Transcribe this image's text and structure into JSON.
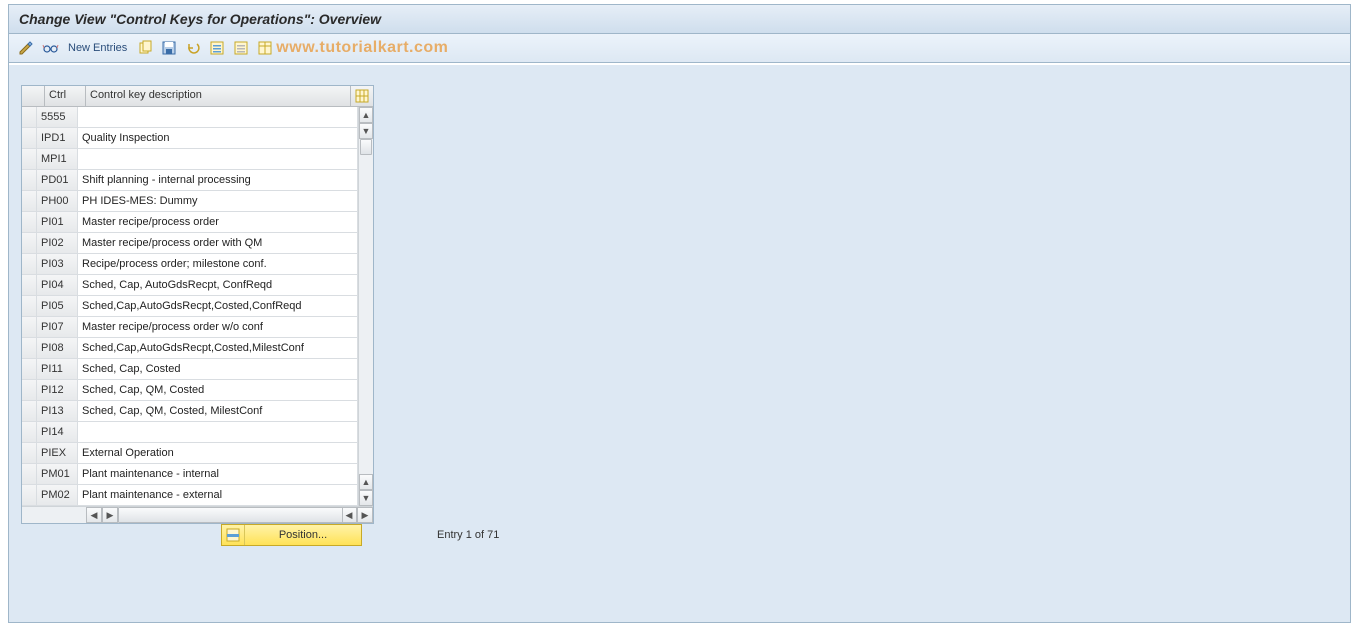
{
  "title": "Change View \"Control Keys for Operations\": Overview",
  "toolbar": {
    "new_entries": "New Entries"
  },
  "watermark": "www.tutorialkart.com",
  "table": {
    "headers": {
      "ctrl": "Ctrl",
      "desc": "Control key description"
    },
    "rows": [
      {
        "ctrl": "5555",
        "desc": ""
      },
      {
        "ctrl": "IPD1",
        "desc": "Quality Inspection"
      },
      {
        "ctrl": "MPI1",
        "desc": ""
      },
      {
        "ctrl": "PD01",
        "desc": "Shift planning - internal processing"
      },
      {
        "ctrl": "PH00",
        "desc": "PH IDES-MES: Dummy"
      },
      {
        "ctrl": "PI01",
        "desc": "Master recipe/process order"
      },
      {
        "ctrl": "PI02",
        "desc": "Master recipe/process order with QM"
      },
      {
        "ctrl": "PI03",
        "desc": "Recipe/process order; milestone conf."
      },
      {
        "ctrl": "PI04",
        "desc": "Sched, Cap, AutoGdsRecpt, ConfReqd"
      },
      {
        "ctrl": "PI05",
        "desc": "Sched,Cap,AutoGdsRecpt,Costed,ConfReqd"
      },
      {
        "ctrl": "PI07",
        "desc": "Master recipe/process order w/o conf"
      },
      {
        "ctrl": "PI08",
        "desc": "Sched,Cap,AutoGdsRecpt,Costed,MilestConf"
      },
      {
        "ctrl": "PI11",
        "desc": "Sched, Cap, Costed"
      },
      {
        "ctrl": "PI12",
        "desc": "Sched, Cap, QM, Costed"
      },
      {
        "ctrl": "PI13",
        "desc": "Sched, Cap, QM, Costed, MilestConf"
      },
      {
        "ctrl": "PI14",
        "desc": ""
      },
      {
        "ctrl": "PIEX",
        "desc": "External Operation"
      },
      {
        "ctrl": "PM01",
        "desc": "Plant maintenance - internal"
      },
      {
        "ctrl": "PM02",
        "desc": "Plant maintenance - external"
      }
    ]
  },
  "position_button": "Position...",
  "entry_text": "Entry 1 of 71"
}
